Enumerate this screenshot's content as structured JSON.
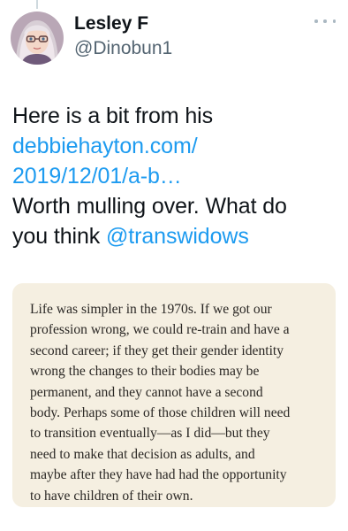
{
  "author": {
    "display_name": "Lesley F",
    "handle": "@Dinobun1"
  },
  "menu": {
    "icon": "more-horizontal-icon"
  },
  "tweet": {
    "text_line1": "Here is a bit from his",
    "link_line1": "debbiehayton.com/",
    "link_line2": "2019/12/01/a-b…",
    "text_line4": "Worth mulling over. What do",
    "text_line5_prefix": "you think ",
    "mention": "@transwidows"
  },
  "quote_image": {
    "lines": [
      "Life was simpler in the 1970s. If we got our",
      "profession wrong, we could re-train and have a",
      "second career; if they get their gender identity",
      "wrong the changes to their bodies may be",
      "permanent, and they cannot have a second",
      "body. Perhaps some of those children will need",
      "to transition eventually—as I did—but they",
      "need to make that decision as adults, and",
      "maybe after they have had had the opportunity",
      "to have children of their own."
    ]
  },
  "colors": {
    "link": "#1d9bf0",
    "card_background": "#f5efe1",
    "secondary_text": "#536471"
  }
}
